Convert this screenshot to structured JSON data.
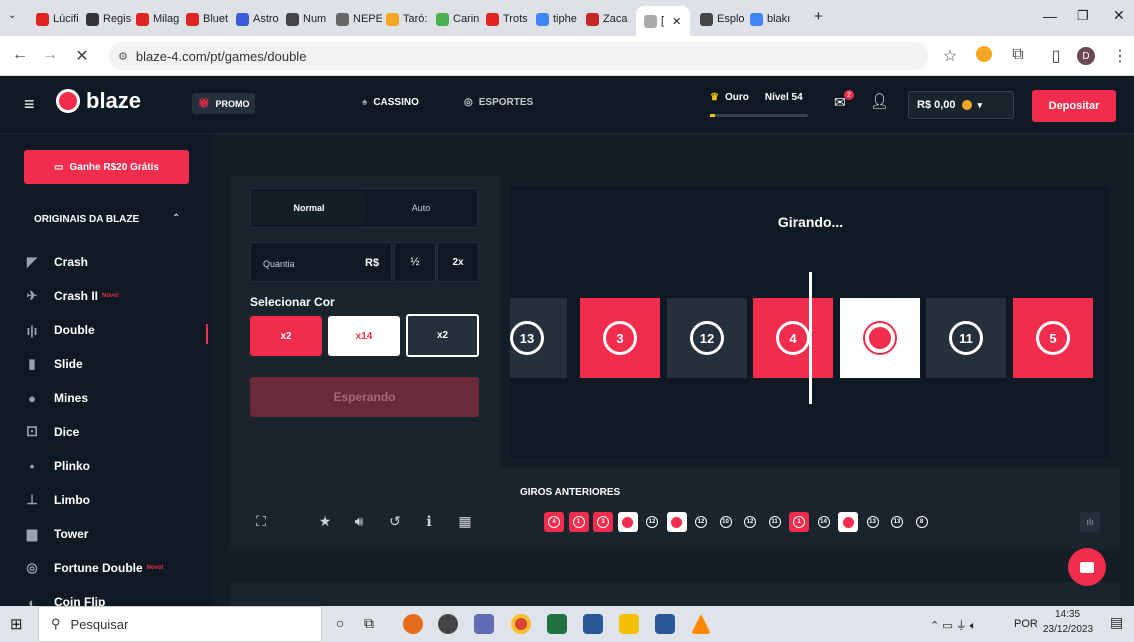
{
  "browser": {
    "tabs": [
      "Lúcifi",
      "Regis",
      "Milag",
      "Bluet",
      "Astro",
      "Num",
      "NEPE",
      "Taró:",
      "Carin",
      "Trots",
      "tiphe",
      "Zaca",
      "[",
      "Esplo",
      "blakı"
    ],
    "url": "blaze-4.com/pt/games/double"
  },
  "header": {
    "logo": "blaze",
    "promo": "PROMO",
    "cassino": "CASSINO",
    "esportes": "ESPORTES",
    "rank": "Ouro",
    "level": "Nível 54",
    "balance": "R$ 0,00",
    "deposit": "Depositar",
    "notif_count": "2"
  },
  "sidebar": {
    "bonus_button": "Ganhe R$20 Grátis",
    "section": "ORIGINAIS DA BLAZE",
    "items": [
      {
        "label": "Crash",
        "badge": "",
        "icon": "crash-icon"
      },
      {
        "label": "Crash II",
        "badge": "Novo!",
        "icon": "crash2-icon"
      },
      {
        "label": "Double",
        "badge": "",
        "icon": "double-icon"
      },
      {
        "label": "Slide",
        "badge": "",
        "icon": "slide-icon"
      },
      {
        "label": "Mines",
        "badge": "",
        "icon": "mines-icon"
      },
      {
        "label": "Dice",
        "badge": "",
        "icon": "dice-icon"
      },
      {
        "label": "Plinko",
        "badge": "",
        "icon": "plinko-icon"
      },
      {
        "label": "Limbo",
        "badge": "",
        "icon": "limbo-icon"
      },
      {
        "label": "Tower",
        "badge": "",
        "icon": "tower-icon"
      },
      {
        "label": "Fortune Double",
        "badge": "Novo!",
        "icon": "fortune-icon"
      },
      {
        "label": "Coin Flip",
        "badge": "",
        "icon": "coin-icon"
      }
    ]
  },
  "bet_panel": {
    "tab_normal": "Normal",
    "tab_auto": "Auto",
    "amount_label": "Quantia",
    "currency": "R$",
    "half": "½",
    "double": "2x",
    "select_color": "Selecionar Cor",
    "color_red": "x2",
    "color_white": "x14",
    "color_black": "x2",
    "action": "Esperando"
  },
  "wheel": {
    "status": "Girando...",
    "tiles": [
      {
        "n": "13",
        "c": "dark"
      },
      {
        "n": "3",
        "c": "red"
      },
      {
        "n": "12",
        "c": "dark"
      },
      {
        "n": "4",
        "c": "red"
      },
      {
        "n": "",
        "c": "white"
      },
      {
        "n": "11",
        "c": "dark"
      },
      {
        "n": "5",
        "c": "red"
      }
    ]
  },
  "history": {
    "title": "GIROS ANTERIORES",
    "items": [
      {
        "n": "4",
        "c": "red"
      },
      {
        "n": "1",
        "c": "red"
      },
      {
        "n": "3",
        "c": "red"
      },
      {
        "n": "",
        "c": "white"
      },
      {
        "n": "12",
        "c": "dark"
      },
      {
        "n": "",
        "c": "white"
      },
      {
        "n": "12",
        "c": "dark"
      },
      {
        "n": "10",
        "c": "dark"
      },
      {
        "n": "12",
        "c": "dark"
      },
      {
        "n": "11",
        "c": "dark"
      },
      {
        "n": "1",
        "c": "red"
      },
      {
        "n": "14",
        "c": "dark"
      },
      {
        "n": "",
        "c": "white"
      },
      {
        "n": "13",
        "c": "dark"
      },
      {
        "n": "13",
        "c": "dark"
      },
      {
        "n": "8",
        "c": "dark"
      }
    ]
  },
  "taskbar": {
    "search": "Pesquisar",
    "lang": "POR",
    "time": "14:35",
    "date": "23/12/2023"
  },
  "colors": {
    "accent": "#f12c4c",
    "bg": "#0f1923",
    "panel": "#1a242d"
  }
}
